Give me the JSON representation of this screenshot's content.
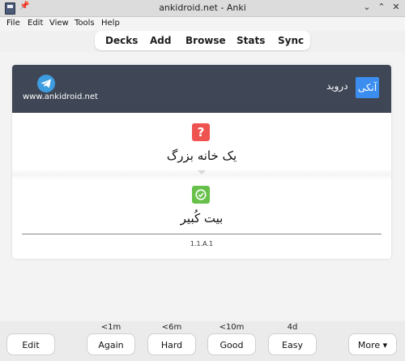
{
  "window": {
    "title": "ankidroid.net - Anki",
    "close_glyph": "✕",
    "min_glyph": "⌄",
    "max_glyph": "⌃"
  },
  "menu": [
    "File",
    "Edit",
    "View",
    "Tools",
    "Help"
  ],
  "toolbar": [
    "Decks",
    "Add",
    "Browse",
    "Stats",
    "Sync"
  ],
  "card": {
    "site": "www.ankidroid.net",
    "rtl_label": "دروید",
    "badge": "آنکی",
    "question_glyph": "?",
    "front": "یک خانه بزرگ",
    "back": "بیت کُبیر",
    "version": "1.1.A.1"
  },
  "bottom": {
    "edit": "Edit",
    "more": "More ▾",
    "answers": [
      {
        "label": "Again",
        "interval": "<1m"
      },
      {
        "label": "Hard",
        "interval": "<6m"
      },
      {
        "label": "Good",
        "interval": "<10m"
      },
      {
        "label": "Easy",
        "interval": "4d"
      }
    ]
  },
  "colors": {
    "header": "#3f4756",
    "badge": "#3b8ef0",
    "question": "#ef5350",
    "check": "#66c04a",
    "telegram": "#3d9de0"
  }
}
